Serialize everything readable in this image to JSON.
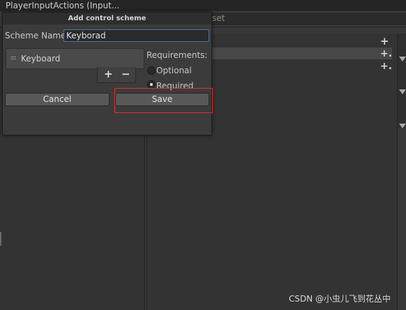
{
  "window": {
    "title": "PlayerInputActions (Input..."
  },
  "toolbar": {
    "partial_text": "set"
  },
  "dialog": {
    "title": "Add control scheme",
    "scheme_name_label": "Scheme Name",
    "scheme_name_value": "Keyborad",
    "devices": [
      {
        "label": "Keyboard"
      }
    ],
    "add_label": "+",
    "remove_label": "−",
    "requirements_label": "Requirements:",
    "optional_label": "Optional",
    "required_label": "Required",
    "required_selected": true,
    "cancel_label": "Cancel",
    "save_label": "Save"
  },
  "actions_panel": {
    "add_icon": "+",
    "binding_add_icon": "+."
  },
  "watermark": "CSDN @小虫儿飞到花丛中",
  "colors": {
    "background": "#383838",
    "highlight": "#e03030",
    "accent_focus": "#3d7ab5"
  }
}
